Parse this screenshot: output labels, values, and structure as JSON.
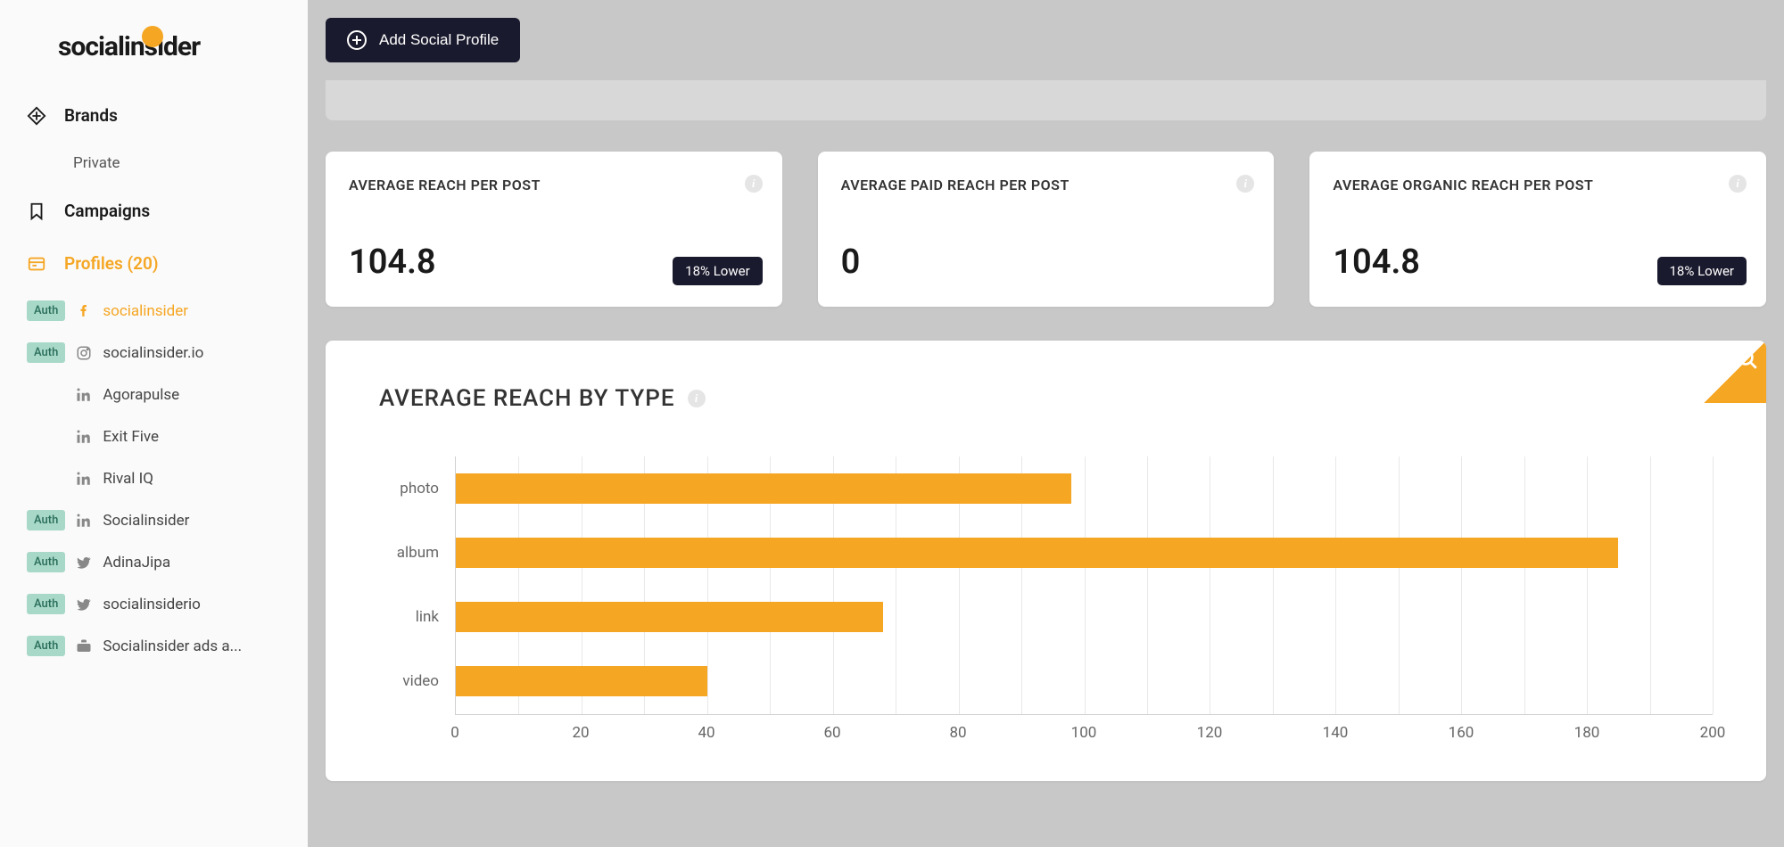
{
  "logo": {
    "text": "socialinsider"
  },
  "sidebar": {
    "brands_label": "Brands",
    "brands_sub": "Private",
    "campaigns_label": "Campaigns",
    "profiles_label": "Profiles (20)",
    "items": [
      {
        "auth": true,
        "icon": "facebook",
        "name": "socialinsider",
        "active": true
      },
      {
        "auth": true,
        "icon": "instagram",
        "name": "socialinsider.io"
      },
      {
        "auth": false,
        "icon": "linkedin",
        "name": "Agorapulse"
      },
      {
        "auth": false,
        "icon": "linkedin",
        "name": "Exit Five"
      },
      {
        "auth": false,
        "icon": "linkedin",
        "name": "Rival IQ"
      },
      {
        "auth": true,
        "icon": "linkedin",
        "name": "Socialinsider"
      },
      {
        "auth": true,
        "icon": "twitter",
        "name": "AdinaJipa"
      },
      {
        "auth": true,
        "icon": "twitter",
        "name": "socialinsiderio"
      },
      {
        "auth": true,
        "icon": "briefcase",
        "name": "Socialinsider ads a..."
      }
    ],
    "auth_label": "Auth"
  },
  "topbar": {
    "add_label": "Add Social Profile"
  },
  "metrics": [
    {
      "title": "AVERAGE REACH PER POST",
      "value": "104.8",
      "badge": "18% Lower"
    },
    {
      "title": "AVERAGE PAID REACH PER POST",
      "value": "0",
      "badge": ""
    },
    {
      "title": "AVERAGE ORGANIC REACH PER POST",
      "value": "104.8",
      "badge": "18% Lower"
    }
  ],
  "chart": {
    "title": "AVERAGE REACH BY TYPE"
  },
  "chart_data": {
    "type": "bar",
    "orientation": "horizontal",
    "categories": [
      "photo",
      "album",
      "link",
      "video"
    ],
    "values": [
      98,
      185,
      68,
      40
    ],
    "xlim": [
      0,
      200
    ],
    "x_ticks": [
      0,
      20,
      40,
      60,
      80,
      100,
      120,
      140,
      160,
      180,
      200
    ],
    "title": "AVERAGE REACH BY TYPE",
    "xlabel": "",
    "ylabel": ""
  }
}
